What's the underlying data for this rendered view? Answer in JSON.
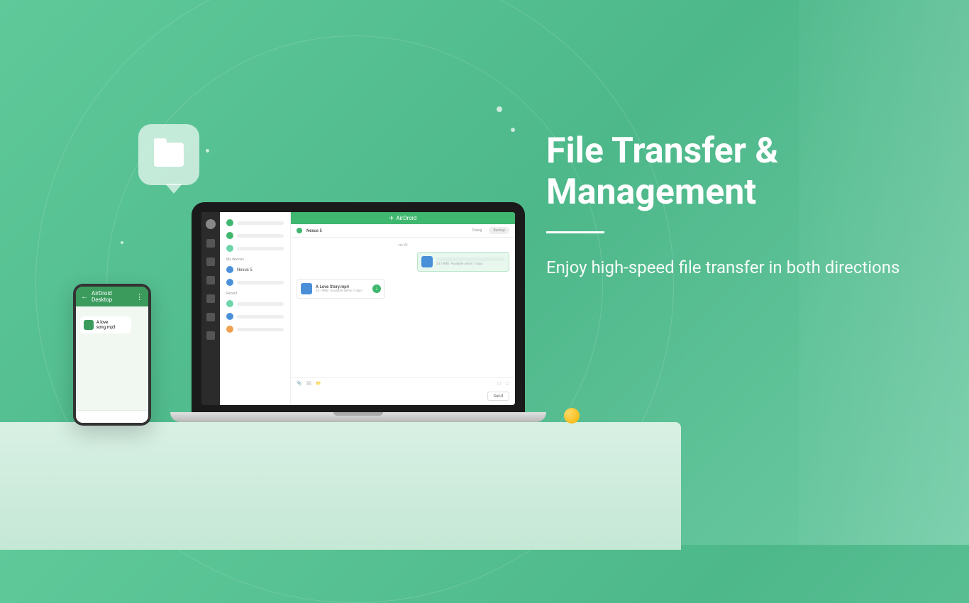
{
  "hero": {
    "title": "File Transfer & Management",
    "subtitle": "Enjoy high-speed file transfer in both directions"
  },
  "phone": {
    "header_title": "AirDroid Desktop",
    "file_name": "A love song.mp3"
  },
  "laptop": {
    "app_brand": "AirDroid",
    "device_name": "Nexus 5",
    "tabs": {
      "dialog": "Dialog",
      "backup": "Backup"
    },
    "sections": {
      "my_devices": "My devices",
      "recent": "Recent"
    },
    "timestamp": "via Wi",
    "file_out": {
      "size": "24.19MB",
      "availability": "Available within 7 days"
    },
    "file_in": {
      "name": "A Love Story.mp4",
      "size": "24.19MB",
      "availability": "Available within 7 days"
    },
    "send_label": "Send"
  },
  "colors": {
    "green": "#3fb76e",
    "blue": "#4a90d9",
    "orange": "#f0a050",
    "light_green": "#6dd5a8"
  }
}
